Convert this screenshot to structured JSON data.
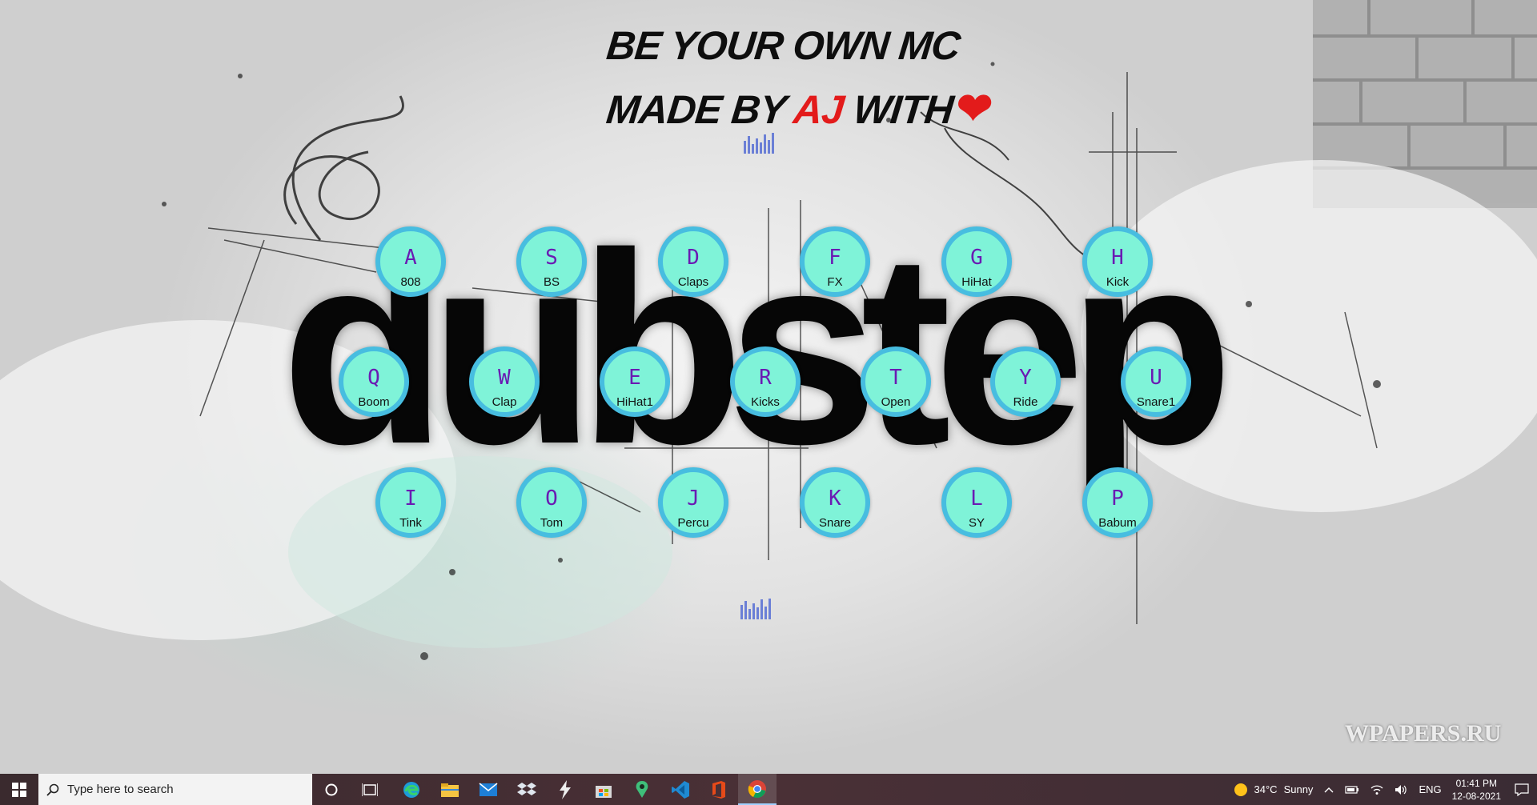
{
  "header": {
    "line1": "BE YOUR OWN MC",
    "line2_prefix": "MADE BY ",
    "line2_author": "AJ",
    "line2_suffix": " WITH",
    "heart": "❤"
  },
  "background": {
    "wordmark": "dubstep",
    "watermark": "WPAPERS.RU"
  },
  "pads": [
    {
      "key": "A",
      "sound": "808"
    },
    {
      "key": "S",
      "sound": "BS"
    },
    {
      "key": "D",
      "sound": "Claps"
    },
    {
      "key": "F",
      "sound": "FX"
    },
    {
      "key": "G",
      "sound": "HiHat"
    },
    {
      "key": "H",
      "sound": "Kick"
    },
    {
      "key": "Q",
      "sound": "Boom"
    },
    {
      "key": "W",
      "sound": "Clap"
    },
    {
      "key": "E",
      "sound": "HiHat1"
    },
    {
      "key": "R",
      "sound": "Kicks"
    },
    {
      "key": "T",
      "sound": "Open"
    },
    {
      "key": "Y",
      "sound": "Ride"
    },
    {
      "key": "U",
      "sound": "Snare1"
    },
    {
      "key": "I",
      "sound": "Tink"
    },
    {
      "key": "O",
      "sound": "Tom"
    },
    {
      "key": "J",
      "sound": "Percu"
    },
    {
      "key": "K",
      "sound": "Snare"
    },
    {
      "key": "L",
      "sound": "SY"
    },
    {
      "key": "P",
      "sound": "Babum"
    }
  ],
  "taskbar": {
    "search_placeholder": "Type here to search",
    "apps": [
      "cortana-icon",
      "task-view-icon",
      "edge-icon",
      "file-explorer-icon",
      "mail-icon",
      "dropbox-icon",
      "winamp-icon",
      "store-icon",
      "maps-icon",
      "vscode-icon",
      "office-icon",
      "chrome-icon"
    ],
    "weather_temp": "34°C",
    "weather_text": "Sunny",
    "language": "ENG",
    "time": "01:41 PM",
    "date": "12-08-2021"
  },
  "colors": {
    "pad_fill": "#7ff3d8",
    "pad_border": "#47bde0",
    "pad_key": "#6a1bb3",
    "accent": "#e31b1b"
  }
}
